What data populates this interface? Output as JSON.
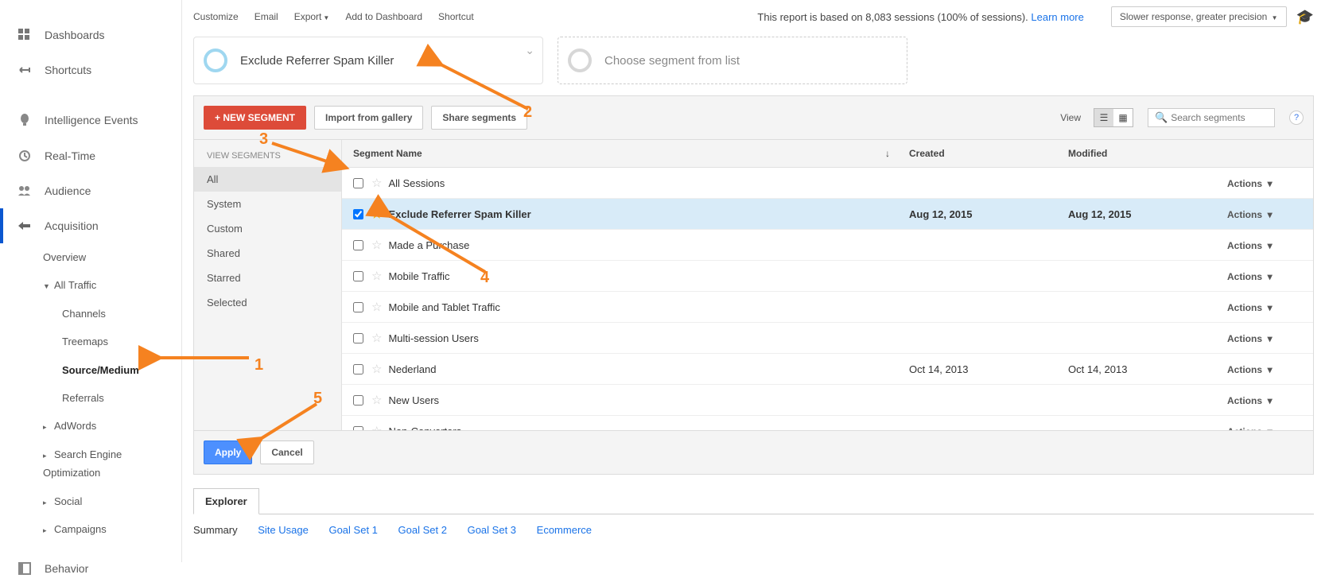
{
  "topbar": {
    "customize": "Customize",
    "email": "Email",
    "export": "Export",
    "addDash": "Add to Dashboard",
    "shortcut": "Shortcut",
    "info_pre": "This report is based on 8,083 sessions (100% of sessions). ",
    "learn": "Learn more",
    "speed": "Slower response, greater precision"
  },
  "nav": {
    "dashboards": "Dashboards",
    "shortcuts": "Shortcuts",
    "intel": "Intelligence Events",
    "realtime": "Real-Time",
    "audience": "Audience",
    "acquisition": "Acquisition",
    "behavior": "Behavior",
    "overview": "Overview",
    "allTraffic": "All Traffic",
    "channels": "Channels",
    "treemaps": "Treemaps",
    "source": "Source/Medium",
    "referrals": "Referrals",
    "adwords": "AdWords",
    "seo": "Search Engine Optimization",
    "social": "Social",
    "campaigns": "Campaigns"
  },
  "segChips": {
    "active": "Exclude Referrer Spam Killer",
    "placeholder": "Choose segment from list"
  },
  "panel": {
    "newSeg": "+ NEW SEGMENT",
    "import": "Import from gallery",
    "share": "Share segments",
    "viewLbl": "View",
    "searchPH": "Search segments",
    "filtersHeader": "VIEW SEGMENTS",
    "filters": [
      "All",
      "System",
      "Custom",
      "Shared",
      "Starred",
      "Selected"
    ],
    "cols": {
      "name": "Segment Name",
      "created": "Created",
      "modified": "Modified"
    },
    "rows": [
      {
        "name": "All Sessions",
        "created": "",
        "modified": "",
        "checked": false,
        "star": false
      },
      {
        "name": "Exclude Referrer Spam Killer",
        "created": "Aug 12, 2015",
        "modified": "Aug 12, 2015",
        "checked": true,
        "star": true
      },
      {
        "name": "Made a Purchase",
        "created": "",
        "modified": "",
        "checked": false,
        "star": false
      },
      {
        "name": "Mobile Traffic",
        "created": "",
        "modified": "",
        "checked": false,
        "star": false
      },
      {
        "name": "Mobile and Tablet Traffic",
        "created": "",
        "modified": "",
        "checked": false,
        "star": false
      },
      {
        "name": "Multi-session Users",
        "created": "",
        "modified": "",
        "checked": false,
        "star": false
      },
      {
        "name": "Nederland",
        "created": "Oct 14, 2013",
        "modified": "Oct 14, 2013",
        "checked": false,
        "star": false
      },
      {
        "name": "New Users",
        "created": "",
        "modified": "",
        "checked": false,
        "star": false
      },
      {
        "name": "Non-Converters",
        "created": "",
        "modified": "",
        "checked": false,
        "star": false
      }
    ],
    "actions": "Actions",
    "apply": "Apply",
    "cancel": "Cancel"
  },
  "explorer": {
    "tab": "Explorer",
    "summary": "Summary",
    "site": "Site Usage",
    "g1": "Goal Set 1",
    "g2": "Goal Set 2",
    "g3": "Goal Set 3",
    "ecom": "Ecommerce"
  },
  "annotations": {
    "n1": "1",
    "n2": "2",
    "n3": "3",
    "n4": "4",
    "n5": "5"
  }
}
